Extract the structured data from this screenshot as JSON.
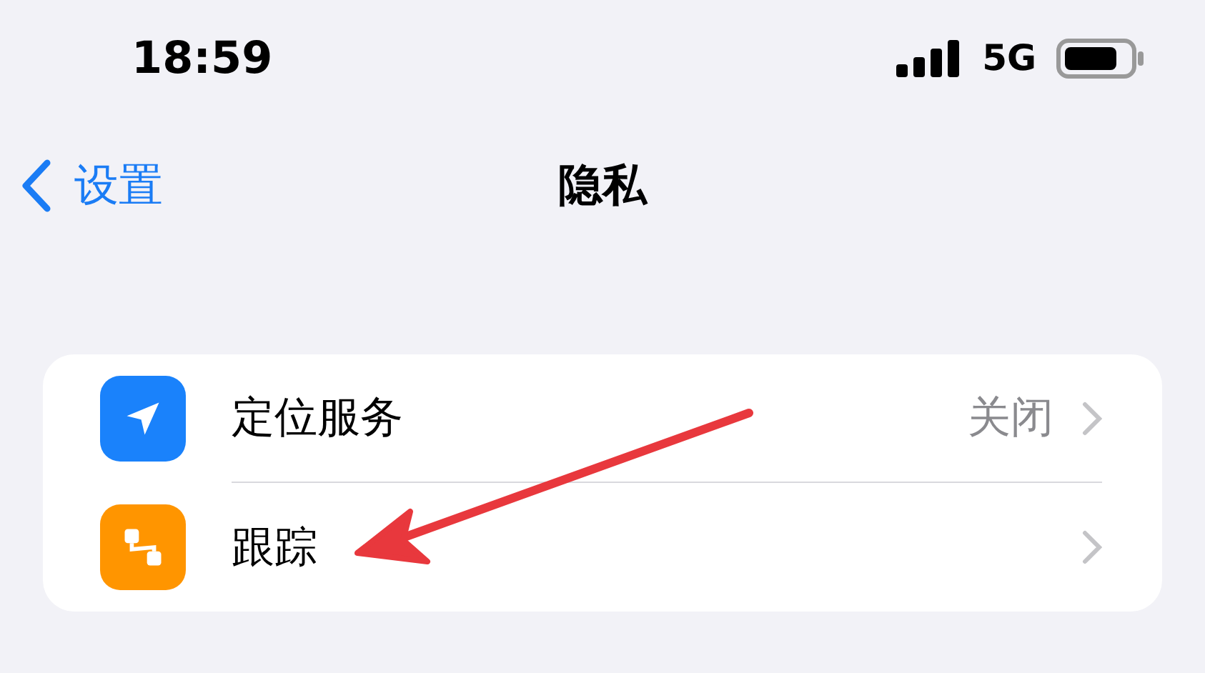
{
  "status_bar": {
    "time": "18:59",
    "network": "5G"
  },
  "nav": {
    "back": "设置",
    "title": "隐私"
  },
  "rows": [
    {
      "kind": "location",
      "label": "定位服务",
      "value": "关闭"
    },
    {
      "kind": "tracking",
      "label": "跟踪"
    }
  ]
}
